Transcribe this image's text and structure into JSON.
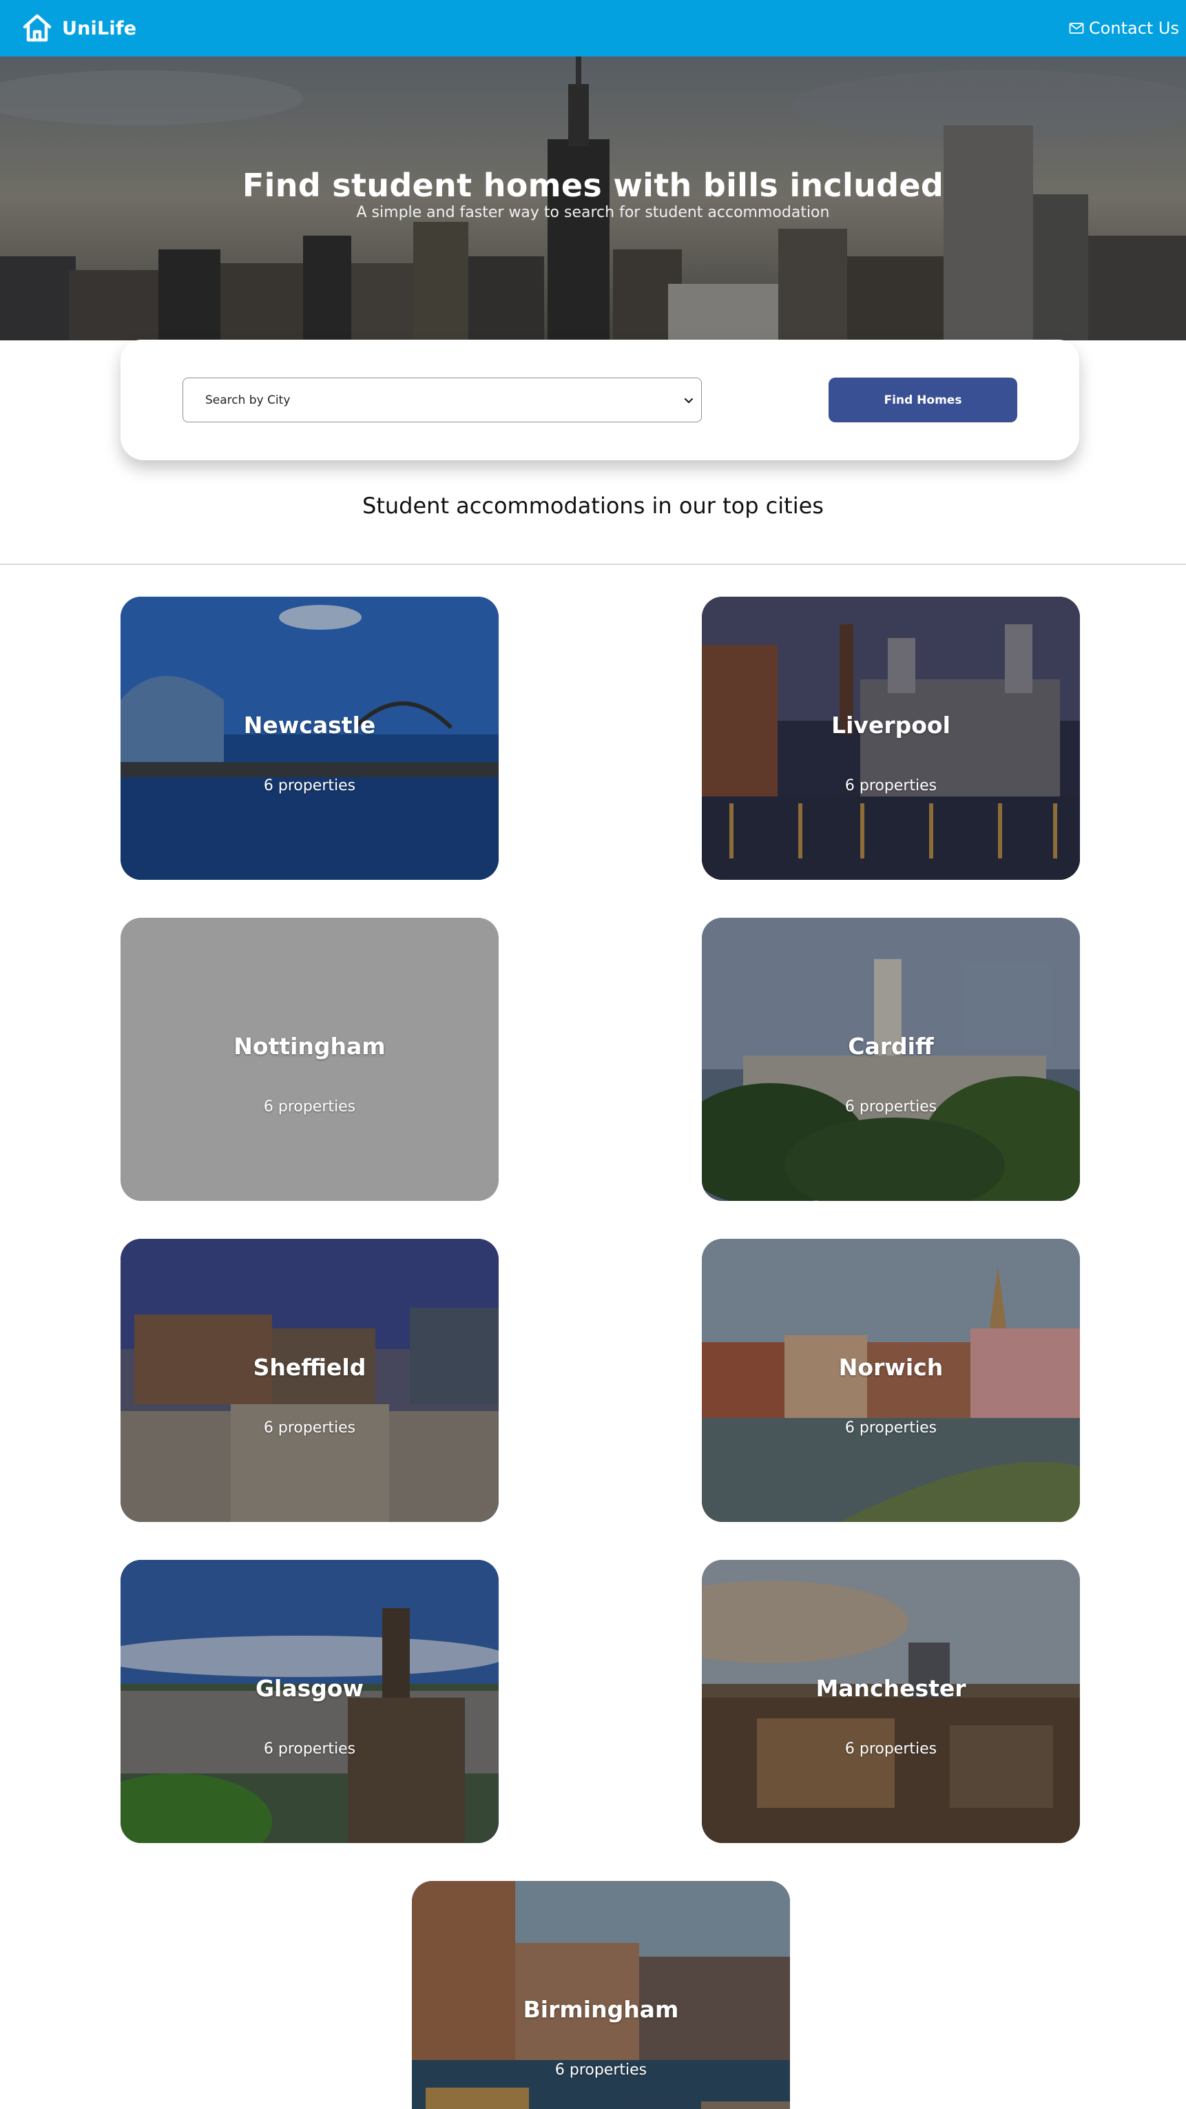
{
  "navbar": {
    "brand_name": "UniLife",
    "brand_icon": "house-icon",
    "contact_label": "Contact Us",
    "contact_icon": "envelope-icon",
    "background_color": "#03a1e0"
  },
  "hero": {
    "title": "Find student homes with bills included",
    "subtitle": "A simple and faster way to search for student accommodation"
  },
  "search": {
    "select_value": "Search by City",
    "button_label": "Find Homes",
    "button_color": "#3a5094"
  },
  "section": {
    "title": "Student accommodations in our top cities"
  },
  "cities": [
    {
      "name": "Newcastle",
      "count": "6 properties"
    },
    {
      "name": "Liverpool",
      "count": "6 properties"
    },
    {
      "name": "Nottingham",
      "count": "6 properties"
    },
    {
      "name": "Cardiff",
      "count": "6 properties"
    },
    {
      "name": "Sheffield",
      "count": "6 properties"
    },
    {
      "name": "Norwich",
      "count": "6 properties"
    },
    {
      "name": "Glasgow",
      "count": "6 properties"
    },
    {
      "name": "Manchester",
      "count": "6 properties"
    },
    {
      "name": "Birmingham",
      "count": "6 properties"
    }
  ]
}
